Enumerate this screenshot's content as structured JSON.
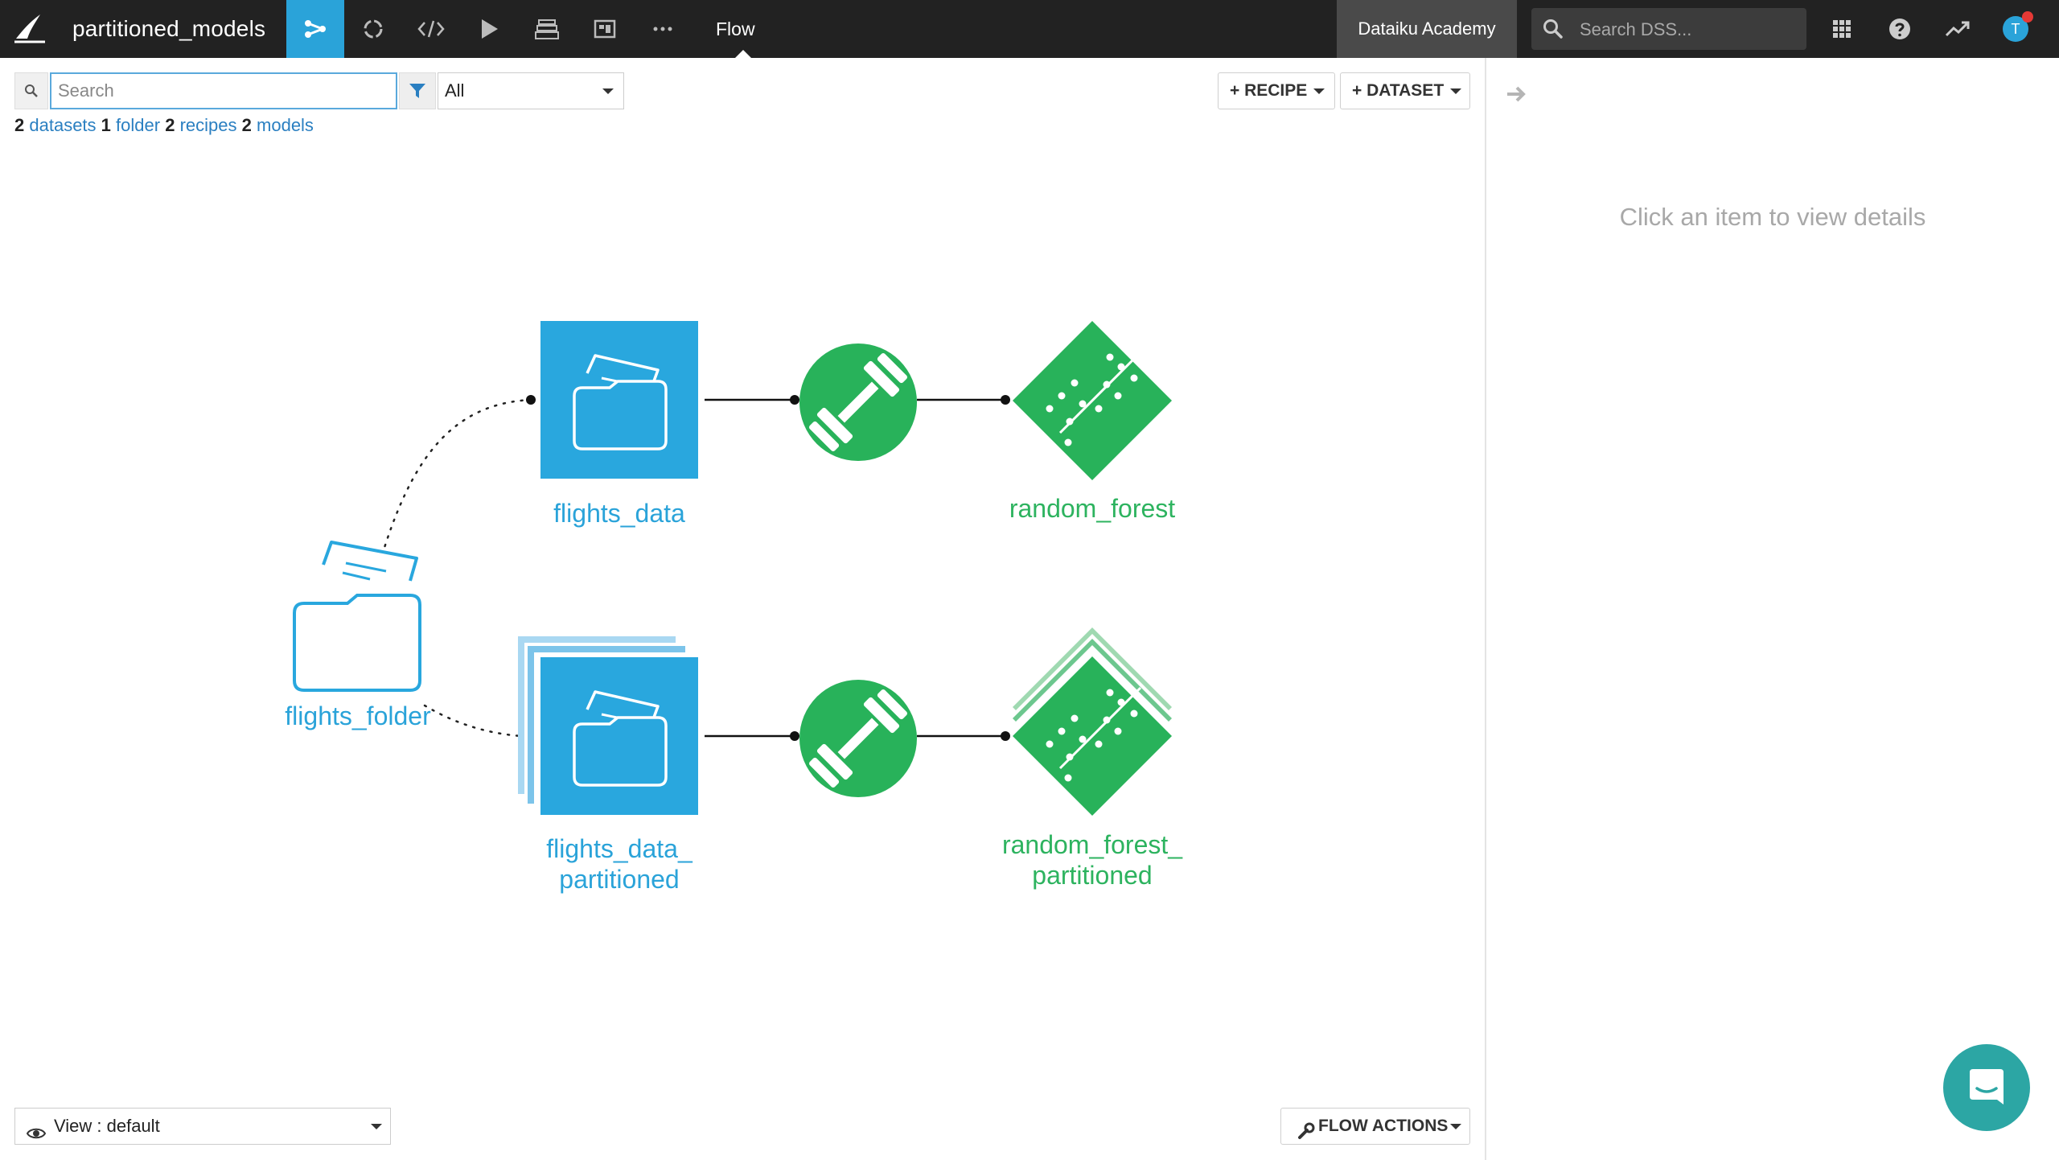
{
  "header": {
    "project_name": "partitioned_models",
    "current_view": "Flow",
    "instance_label": "Dataiku Academy",
    "search_placeholder": "Search DSS...",
    "avatar_initial": "T",
    "nav_icons": [
      "flow-icon",
      "code-cycle-icon",
      "code-icon",
      "run-icon",
      "stack-icon",
      "dashboard-icon",
      "more-icon"
    ]
  },
  "toolbar": {
    "search_placeholder": "Search",
    "filter_value": "All",
    "recipe_button": "+ RECIPE",
    "dataset_button": "+ DATASET"
  },
  "summary": {
    "datasets_count": "2",
    "datasets_label": "datasets",
    "folders_count": "1",
    "folders_label": "folder",
    "recipes_count": "2",
    "recipes_label": "recipes",
    "models_count": "2",
    "models_label": "models"
  },
  "flow": {
    "nodes": [
      {
        "id": "flights_folder",
        "type": "folder",
        "label": "flights_folder"
      },
      {
        "id": "flights_data",
        "type": "dataset",
        "label": "flights_data"
      },
      {
        "id": "flights_data_partitioned",
        "type": "dataset_partitioned",
        "label_line1": "flights_data_",
        "label_line2": "partitioned"
      },
      {
        "id": "train_recipe_1",
        "type": "train_recipe",
        "label": ""
      },
      {
        "id": "train_recipe_2",
        "type": "train_recipe",
        "label": ""
      },
      {
        "id": "random_forest",
        "type": "model",
        "label": "random_forest"
      },
      {
        "id": "random_forest_partitioned",
        "type": "model_partitioned",
        "label_line1": "random_forest_",
        "label_line2": "partitioned"
      }
    ],
    "edges": [
      {
        "from": "flights_folder",
        "to": "flights_data",
        "style": "dotted"
      },
      {
        "from": "flights_folder",
        "to": "flights_data_partitioned",
        "style": "dotted"
      },
      {
        "from": "flights_data",
        "to": "train_recipe_1",
        "style": "solid"
      },
      {
        "from": "train_recipe_1",
        "to": "random_forest",
        "style": "solid"
      },
      {
        "from": "flights_data_partitioned",
        "to": "train_recipe_2",
        "style": "solid"
      },
      {
        "from": "train_recipe_2",
        "to": "random_forest_partitioned",
        "style": "solid"
      }
    ],
    "colors": {
      "dataset": "#29a7de",
      "model": "#28b25a",
      "model_light": "#9fd9b1",
      "dataset_light": "#a9d8f2"
    }
  },
  "footer": {
    "view_label": "View : default",
    "flow_actions": "FLOW ACTIONS"
  },
  "right_panel": {
    "empty_text": "Click an item to view details"
  }
}
